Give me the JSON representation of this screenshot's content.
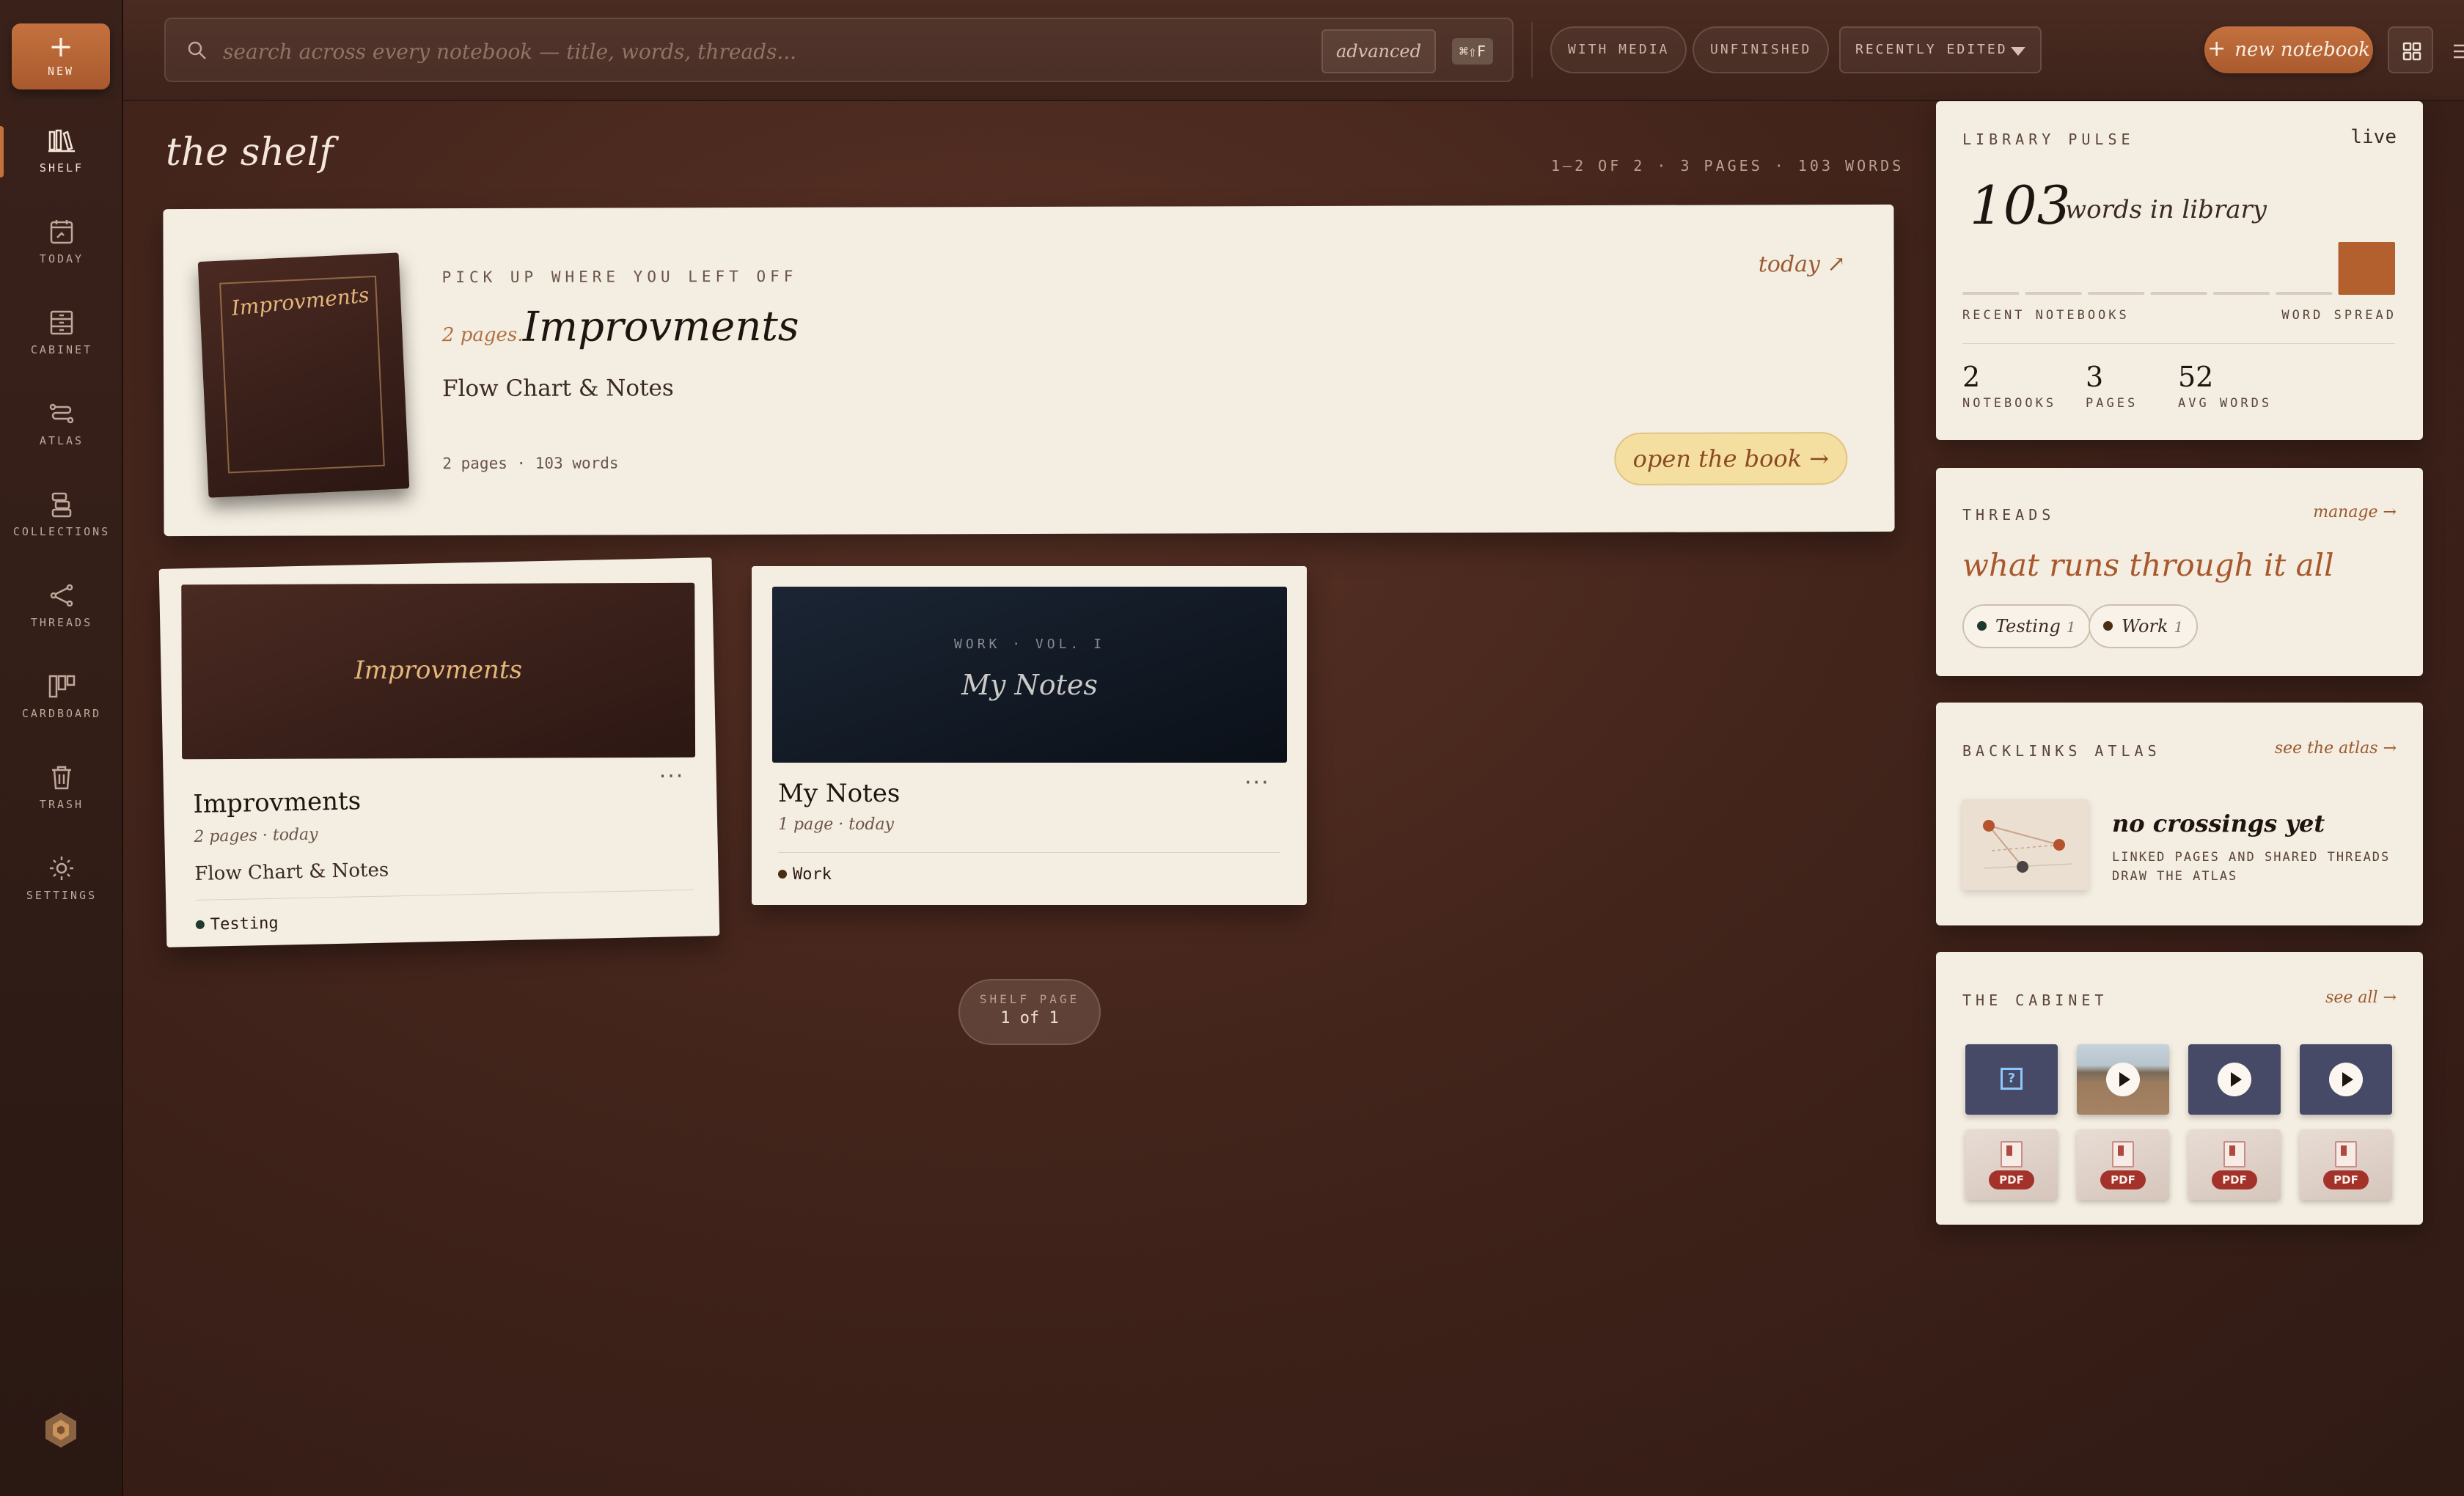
{
  "rail": {
    "new_label": "NEW",
    "items": [
      {
        "label": "SHELF",
        "icon": "shelf-icon",
        "active": true
      },
      {
        "label": "TODAY",
        "icon": "calendar-icon"
      },
      {
        "label": "CABINET",
        "icon": "cabinet-icon"
      },
      {
        "label": "ATLAS",
        "icon": "atlas-icon"
      },
      {
        "label": "COLLECTIONS",
        "icon": "collections-icon"
      },
      {
        "label": "THREADS",
        "icon": "threads-icon"
      },
      {
        "label": "CARDBOARD",
        "icon": "cardboard-icon"
      },
      {
        "label": "TRASH",
        "icon": "trash-icon"
      },
      {
        "label": "SETTINGS",
        "icon": "settings-icon"
      }
    ]
  },
  "topbar": {
    "search_placeholder": "search across every notebook — title, words, threads...",
    "advanced_label": "advanced",
    "shortcut": "⌘⇧F",
    "filters": [
      "WITH MEDIA",
      "UNFINISHED"
    ],
    "sort_value": "RECENTLY EDITED",
    "new_notebook_label": "new notebook"
  },
  "shelf": {
    "title": "the shelf",
    "count": "1–2 OF 2 · 3 PAGES · 103 WORDS"
  },
  "hero": {
    "cover_title": "Improvments",
    "kicker": "PICK UP WHERE YOU LEFT OFF",
    "pages": "2 pages.",
    "name": "Improvments",
    "subtitle": "Flow Chart & Notes",
    "meta": "2 pages · 103 words",
    "when": "today ↗",
    "open_label": "open the book →"
  },
  "notebooks": [
    {
      "cover_title": "Improvments",
      "cover_color": "#3d211b",
      "title": "Improvments",
      "meta": "2 pages · today",
      "subtitle": "Flow Chart & Notes",
      "tag": "Testing",
      "tag_color": "#1f3a2c",
      "more": "···"
    },
    {
      "cover_kicker": "WORK · VOL. I",
      "cover_title": "My Notes",
      "cover_color": "#121a26",
      "title": "My Notes",
      "meta": "1 page · today",
      "tag": "Work",
      "tag_color": "#4a2e14",
      "more": "···"
    }
  ],
  "pager": {
    "label": "SHELF PAGE",
    "value": "1 of 1"
  },
  "pulse": {
    "title": "LIBRARY PULSE",
    "status": "live",
    "words": "103",
    "words_unit": "words in library",
    "left_label": "RECENT NOTEBOOKS",
    "right_label": "WORD SPREAD",
    "spread": [
      0,
      0,
      0,
      0,
      0,
      0,
      103
    ],
    "stats": [
      {
        "value": "2",
        "label": "NOTEBOOKS"
      },
      {
        "value": "3",
        "label": "PAGES"
      },
      {
        "value": "52",
        "label": "AVG WORDS"
      }
    ]
  },
  "threads": {
    "title": "THREADS",
    "link": "manage →",
    "tagline": "what runs through it all",
    "items": [
      {
        "name": "Testing",
        "count": "1",
        "color": "#1f3a2c"
      },
      {
        "name": "Work",
        "count": "1",
        "color": "#4a2e14"
      }
    ]
  },
  "atlas": {
    "title": "BACKLINKS ATLAS",
    "link": "see the atlas →",
    "heading": "no crossings yet",
    "text": "LINKED PAGES AND SHARED THREADS DRAW THE ATLAS"
  },
  "cabinet": {
    "title": "THE CABINET",
    "link": "see all →",
    "pdf_label": "PDF"
  }
}
